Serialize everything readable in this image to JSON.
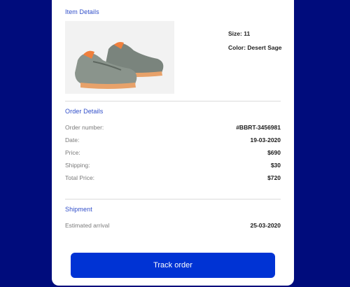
{
  "item_details": {
    "title": "Item Details",
    "product_image": "sneaker-image",
    "size": "Size: 11",
    "color": "Color: Desert Sage"
  },
  "order_details": {
    "title": "Order Details",
    "rows": [
      {
        "label": "Order number:",
        "value": "#BBRT-3456981"
      },
      {
        "label": "Date:",
        "value": "19-03-2020"
      },
      {
        "label": "Price:",
        "value": "$690"
      },
      {
        "label": "Shipping:",
        "value": "$30"
      },
      {
        "label": "Total Price:",
        "value": "$720"
      }
    ]
  },
  "shipment": {
    "title": "Shipment",
    "label": "Estimated arrival",
    "value": "25-03-2020"
  },
  "actions": {
    "track_label": "Track order"
  },
  "colors": {
    "page_background": "#000c7c",
    "accent": "#2f4dc9",
    "button": "#0033d4"
  }
}
